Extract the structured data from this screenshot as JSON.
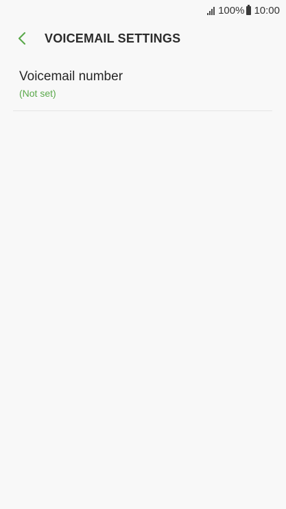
{
  "status_bar": {
    "battery_percent": "100%",
    "time": "10:00",
    "icons": [
      "signal-icon",
      "battery-icon"
    ]
  },
  "header": {
    "back_icon": "chevron-left-icon",
    "title": "VOICEMAIL SETTINGS",
    "accent_color": "#5aa84a"
  },
  "settings": {
    "items": [
      {
        "label": "Voicemail number",
        "value": "(Not set)"
      }
    ]
  }
}
